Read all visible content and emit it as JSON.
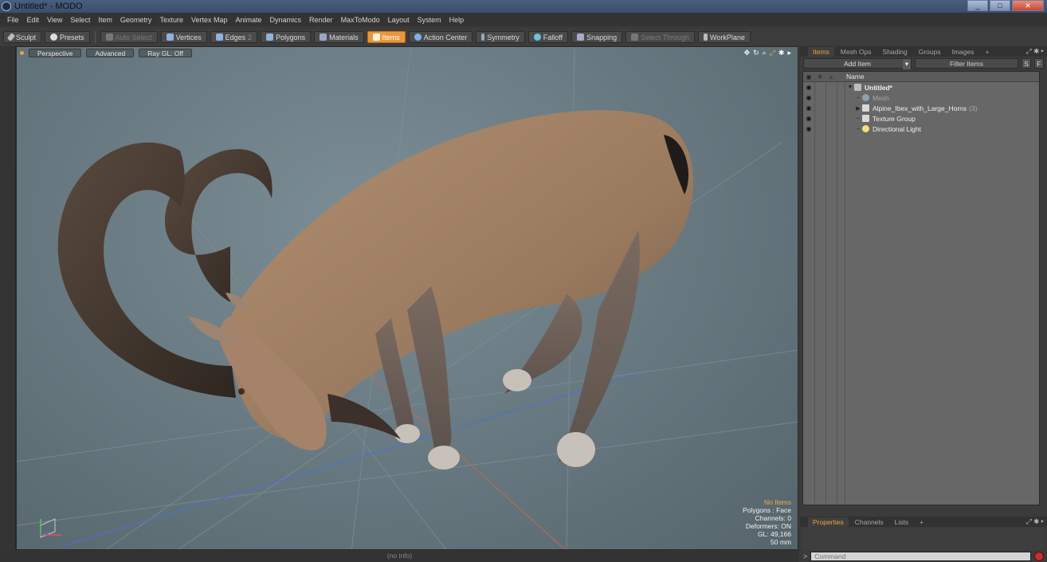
{
  "window": {
    "title": "Untitled* - MODO",
    "minimize": "_",
    "maximize": "□",
    "close": "✕"
  },
  "menu": [
    "File",
    "Edit",
    "View",
    "Select",
    "Item",
    "Geometry",
    "Texture",
    "Vertex Map",
    "Animate",
    "Dynamics",
    "Render",
    "MaxToModo",
    "Layout",
    "System",
    "Help"
  ],
  "toolbar": {
    "sculpt": "Sculpt",
    "presets": "Presets",
    "auto_select": "Auto Select",
    "vertices": "Vertices",
    "edges": "Edges",
    "edges_count": "2",
    "polygons": "Polygons",
    "materials": "Materials",
    "items": "Items",
    "action_center": "Action Center",
    "symmetry": "Symmetry",
    "falloff": "Falloff",
    "snapping": "Snapping",
    "select_through": "Select Through",
    "workplane": "WorkPlane"
  },
  "viewport": {
    "tabs": [
      "Perspective",
      "Advanced",
      "Ray GL: Off"
    ],
    "hud": {
      "selection": "No Items",
      "polygons": "Polygons : Face",
      "channels": "Channels: 0",
      "deformers": "Deformers: ON",
      "gl": "GL: 49,166",
      "scale": "50 mm"
    }
  },
  "status": {
    "info": "(no info)"
  },
  "panel": {
    "tabs": [
      "Items",
      "Mesh Ops",
      "Shading",
      "Groups",
      "Images",
      "+"
    ],
    "add_item": "Add Item",
    "filter_placeholder": "Filter Items",
    "s_btn": "S",
    "f_btn": "F",
    "column_name": "Name",
    "tree": [
      {
        "label": "Untitled*",
        "type": "scene"
      },
      {
        "label": "Mesh",
        "type": "mesh"
      },
      {
        "label": "Alpine_Ibex_with_Large_Horns",
        "type": "group",
        "count": "(3)"
      },
      {
        "label": "Texture Group",
        "type": "group"
      },
      {
        "label": "Directional Light",
        "type": "light"
      }
    ],
    "bottom_tabs": [
      "Properties",
      "Channels",
      "Lists",
      "+"
    ],
    "command_placeholder": "Command"
  },
  "colors": {
    "accent": "#e9973a",
    "viewport_bg": "#6a7b83",
    "animal_fur": "#a9886b"
  }
}
